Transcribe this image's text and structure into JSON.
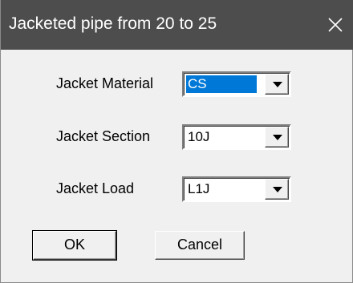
{
  "window": {
    "title": "Jacketed pipe from 20 to 25"
  },
  "fields": [
    {
      "label": "Jacket Material",
      "value": "CS"
    },
    {
      "label": "Jacket Section",
      "value": "10J"
    },
    {
      "label": "Jacket Load",
      "value": "L1J"
    }
  ],
  "buttons": {
    "ok_label": "OK",
    "cancel_label": "Cancel"
  },
  "icons": {
    "close": "close-icon",
    "dropdown": "chevron-down-icon"
  },
  "colors": {
    "titlebar": "#4d4d4d",
    "selection": "#0078d7",
    "dialog_bg": "#f0f0f0"
  }
}
